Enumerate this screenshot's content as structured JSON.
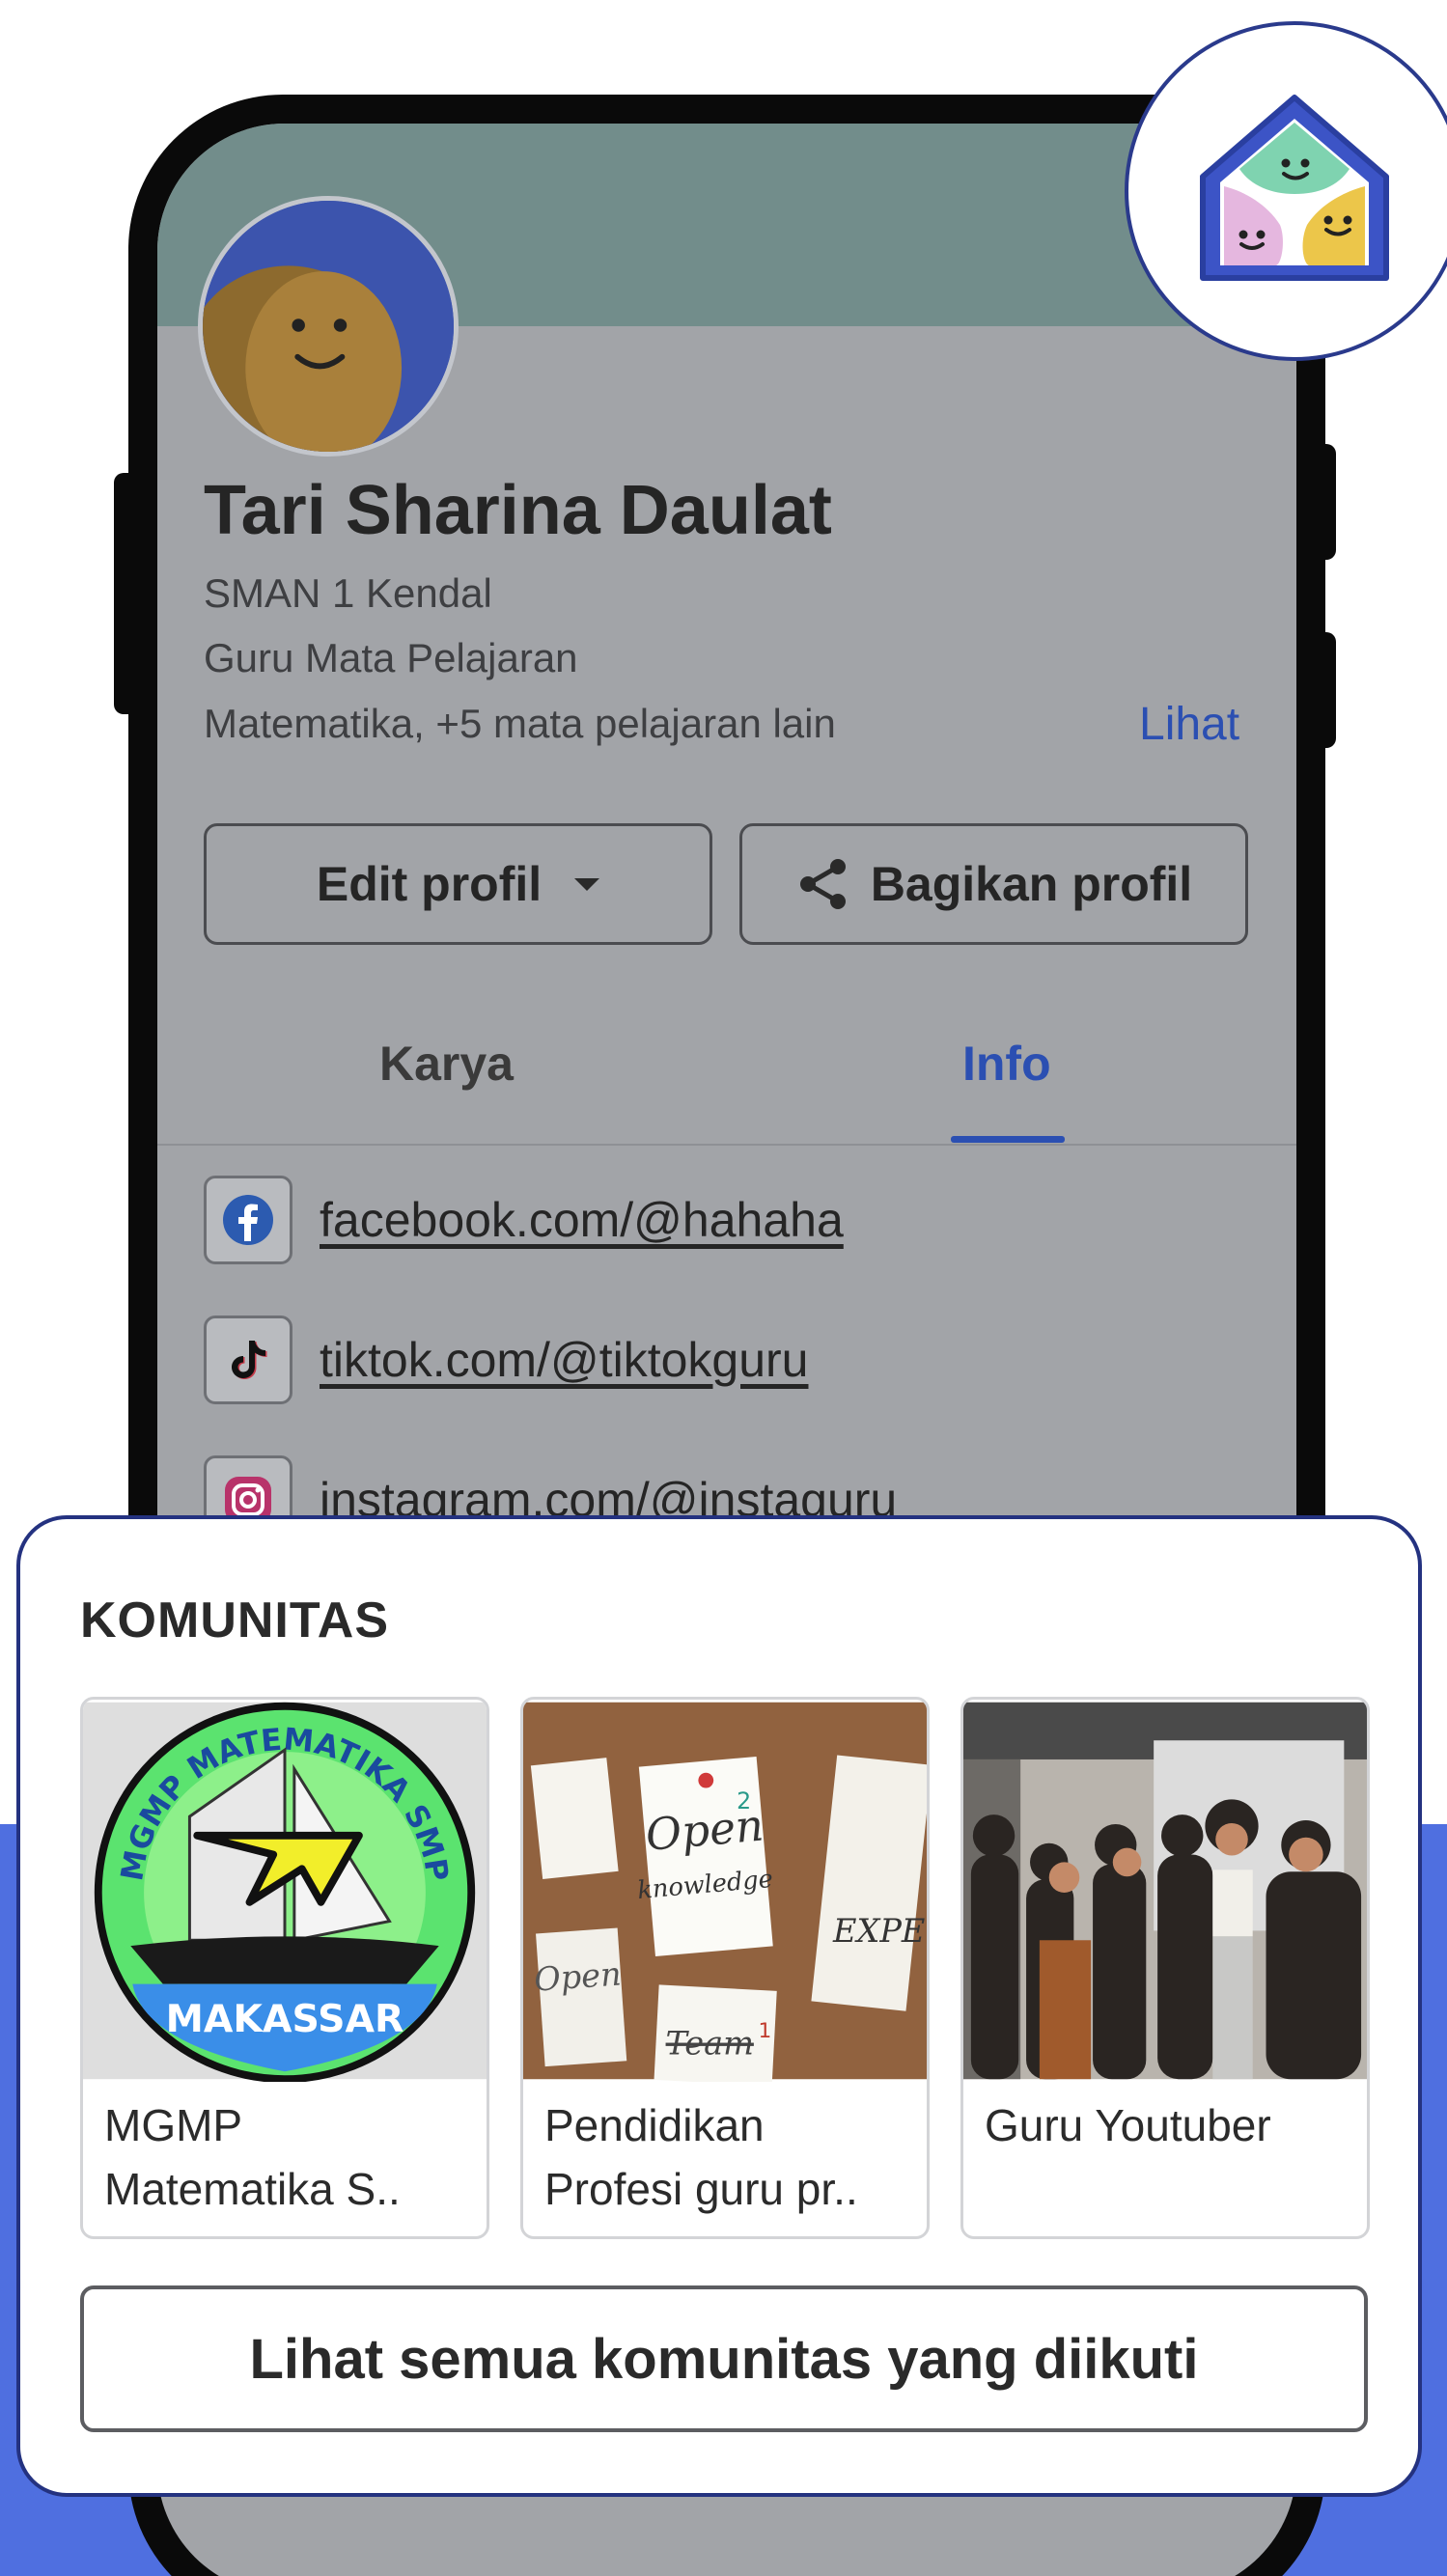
{
  "profile": {
    "name": "Tari Sharina Daulat",
    "school": "SMAN 1 Kendal",
    "role": "Guru Mata Pelajaran",
    "subjects": "Matematika, +5 mata pelajaran lain",
    "see_link": "Lihat"
  },
  "actions": {
    "edit_label": "Edit profil",
    "share_label": "Bagikan profil"
  },
  "tabs": [
    {
      "label": "Karya",
      "active": false
    },
    {
      "label": "Info",
      "active": true
    }
  ],
  "socials": [
    {
      "icon": "facebook-icon",
      "url": "facebook.com/@hahaha"
    },
    {
      "icon": "tiktok-icon",
      "url": "tiktok.com/@tiktokguru"
    },
    {
      "icon": "instagram-icon",
      "url": "instagram.com/@instaguru"
    }
  ],
  "community": {
    "title": "KOMUNITAS",
    "items": [
      {
        "label": "MGMP Matematika S..",
        "thumb": "mgmp-matematika-smp-makassar-logo",
        "logo_ring_text": "MGMP MATEMATIKA SMP",
        "logo_banner_text": "MAKASSAR"
      },
      {
        "label": "Pendidikan Profesi guru pr..",
        "thumb": "corkboard-notes-photo",
        "note_texts": [
          "Open",
          "knowledge",
          "2",
          "Open",
          "Team",
          "1",
          "EXPE"
        ]
      },
      {
        "label": "Guru Youtuber",
        "thumb": "group-photo"
      }
    ],
    "see_all_label": "Lihat semua komunitas yang diikuti"
  },
  "colors": {
    "accent_blue": "#2b4fb2",
    "band_blue": "#4f6fe0",
    "cover_teal": "#728d8b",
    "card_border": "#243280"
  }
}
